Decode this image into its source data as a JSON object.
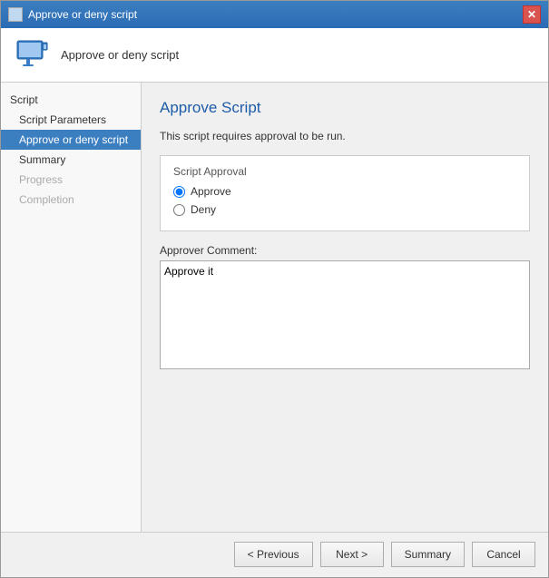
{
  "window": {
    "title": "Approve or deny script",
    "close_label": "✕"
  },
  "header": {
    "title": "Approve or deny script"
  },
  "sidebar": {
    "section_label": "Script",
    "items": [
      {
        "id": "script-parameters",
        "label": "Script Parameters",
        "state": "normal"
      },
      {
        "id": "approve-or-deny-script",
        "label": "Approve or deny script",
        "state": "active"
      },
      {
        "id": "summary",
        "label": "Summary",
        "state": "normal"
      },
      {
        "id": "progress",
        "label": "Progress",
        "state": "disabled"
      },
      {
        "id": "completion",
        "label": "Completion",
        "state": "disabled"
      }
    ]
  },
  "main": {
    "title": "Approve Script",
    "description": "This script requires approval to be run.",
    "script_approval_label": "Script Approval",
    "approve_label": "Approve",
    "deny_label": "Deny",
    "approver_comment_label": "Approver Comment:",
    "comment_value": "Approve it"
  },
  "footer": {
    "previous_label": "< Previous",
    "next_label": "Next >",
    "summary_label": "Summary",
    "cancel_label": "Cancel"
  }
}
